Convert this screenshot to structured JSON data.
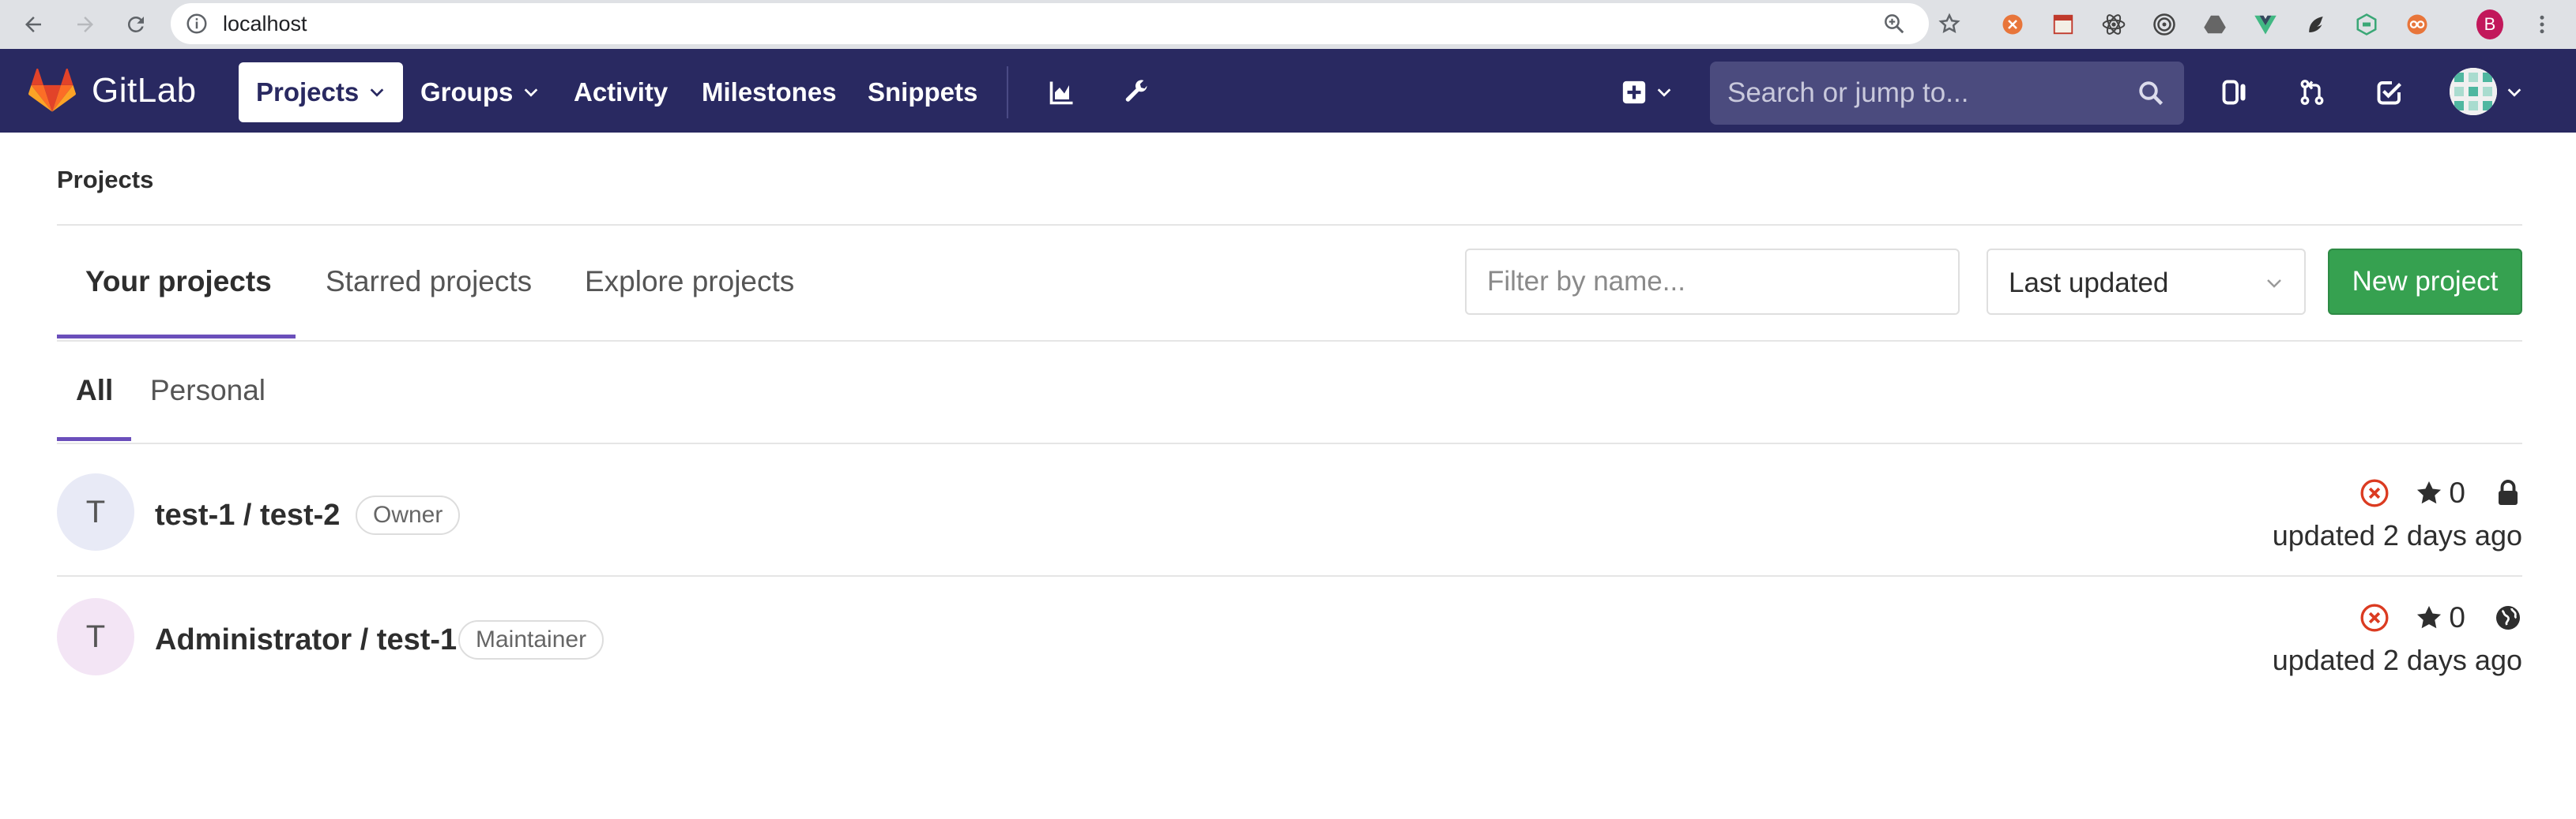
{
  "browser": {
    "url": "localhost",
    "profile_initial": "B"
  },
  "header": {
    "brand": "GitLab",
    "nav": {
      "projects": "Projects",
      "groups": "Groups",
      "activity": "Activity",
      "milestones": "Milestones",
      "snippets": "Snippets"
    },
    "search_placeholder": "Search or jump to..."
  },
  "page": {
    "breadcrumb": "Projects",
    "tabs": {
      "yours": "Your projects",
      "starred": "Starred projects",
      "explore": "Explore projects"
    },
    "filter_placeholder": "Filter by name...",
    "sort_value": "Last updated",
    "new_project_label": "New project",
    "subtabs": {
      "all": "All",
      "personal": "Personal"
    }
  },
  "projects": [
    {
      "avatar_letter": "T",
      "title": "test-1 / test-2",
      "role": "Owner",
      "stars": "0",
      "visibility": "lock-icon",
      "updated": "updated 2 days ago"
    },
    {
      "avatar_letter": "T",
      "title": "Administrator / test-1",
      "role": "Maintainer",
      "stars": "0",
      "visibility": "globe-icon",
      "updated": "updated 2 days ago"
    }
  ],
  "colors": {
    "header_bg": "#292961",
    "accent_underline": "#6b4fbb",
    "new_project_bg": "#36a150",
    "ci_failed": "#db3b21"
  }
}
